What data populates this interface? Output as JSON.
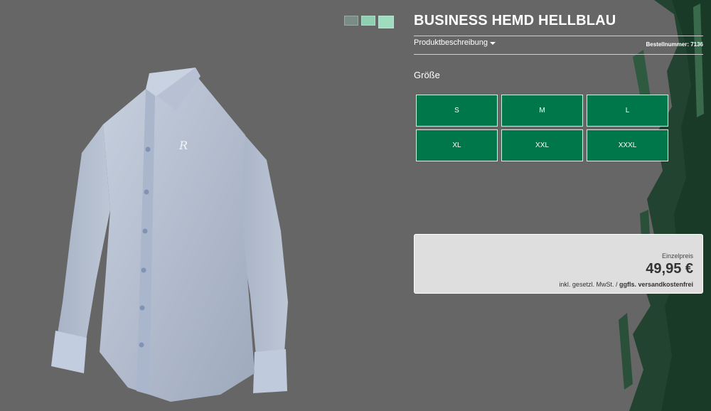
{
  "product": {
    "title": "BUSINESS HEMD HELLBLAU",
    "description_toggle": "Produktbeschreibung",
    "order_number": "Bestellnummer: 7136",
    "image_icon": "shirt-image"
  },
  "swatches": [
    {
      "color": "#7a8c86"
    },
    {
      "color": "#8fcfb2"
    },
    {
      "color": "#9fdcc0"
    }
  ],
  "size": {
    "label": "Größe",
    "options": [
      "S",
      "M",
      "L",
      "XL",
      "XXL",
      "XXXL"
    ]
  },
  "price": {
    "label": "Einzelpreis",
    "value": "49,95 €",
    "note_prefix": "inkl. gesetzl. MwSt. / ",
    "note_link": "ggfls. versandkostenfrei"
  },
  "colors": {
    "background": "#666666",
    "accent_green": "#00774a",
    "brush_green": "#1e4a32"
  }
}
